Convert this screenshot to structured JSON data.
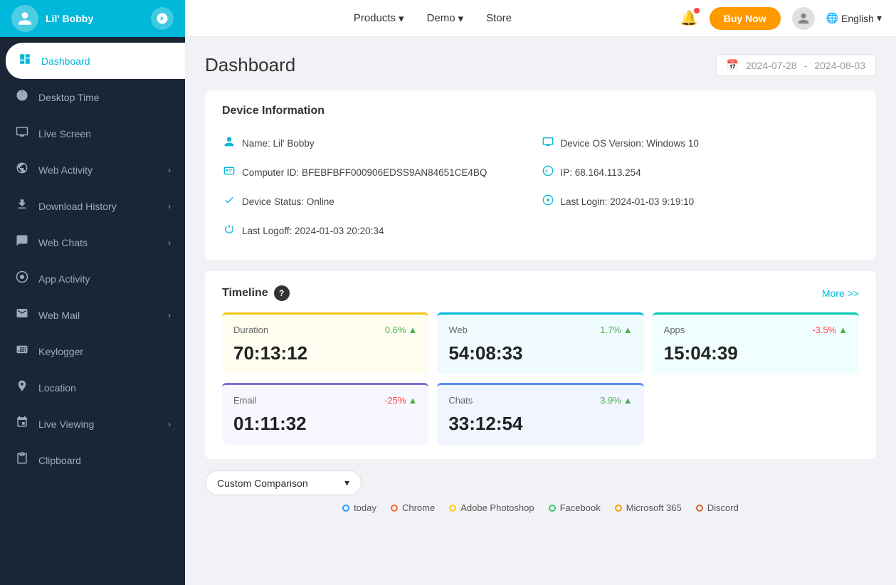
{
  "topNav": {
    "userName": "Lil' Bobby",
    "products": "Products",
    "demo": "Demo",
    "store": "Store",
    "buyNow": "Buy Now",
    "language": "English"
  },
  "sidebar": {
    "items": [
      {
        "id": "dashboard",
        "label": "Dashboard",
        "icon": "⊙",
        "active": true,
        "hasChevron": false
      },
      {
        "id": "desktop-time",
        "label": "Desktop Time",
        "icon": "🕐",
        "active": false,
        "hasChevron": false
      },
      {
        "id": "live-screen",
        "label": "Live Screen",
        "icon": "🖥",
        "active": false,
        "hasChevron": false
      },
      {
        "id": "web-activity",
        "label": "Web Activity",
        "icon": "🌐",
        "active": false,
        "hasChevron": true
      },
      {
        "id": "download-history",
        "label": "Download History",
        "icon": "⬇",
        "active": false,
        "hasChevron": true
      },
      {
        "id": "web-chats",
        "label": "Web Chats",
        "icon": "💬",
        "active": false,
        "hasChevron": true
      },
      {
        "id": "app-activity",
        "label": "App Activity",
        "icon": "⊙",
        "active": false,
        "hasChevron": false
      },
      {
        "id": "web-mail",
        "label": "Web Mail",
        "icon": "✉",
        "active": false,
        "hasChevron": true
      },
      {
        "id": "keylogger",
        "label": "Keylogger",
        "icon": "⌨",
        "active": false,
        "hasChevron": false
      },
      {
        "id": "location",
        "label": "Location",
        "icon": "📍",
        "active": false,
        "hasChevron": false
      },
      {
        "id": "live-viewing",
        "label": "Live Viewing",
        "icon": "📅",
        "active": false,
        "hasChevron": true
      },
      {
        "id": "clipboard",
        "label": "Clipboard",
        "icon": "📋",
        "active": false,
        "hasChevron": false
      }
    ]
  },
  "dashboard": {
    "title": "Dashboard",
    "dateFrom": "2024-07-28",
    "dateTo": "2024-08-03",
    "dateSeparator": "-"
  },
  "deviceInfo": {
    "sectionTitle": "Device Information",
    "name": "Name: Lil' Bobby",
    "deviceOS": "Device OS Version: Windows 10",
    "computerID": "Computer ID: BFEBFBFF000906EDSS9AN84651CE4BQ",
    "ip": "IP: 68.164.113.254",
    "deviceStatus": "Device Status: Online",
    "lastLogin": "Last Login: 2024-01-03 9:19:10",
    "lastLogoff": "Last Logoff: 2024-01-03 20:20:34"
  },
  "timeline": {
    "title": "Timeline",
    "moreLabel": "More >>",
    "stats": [
      {
        "label": "Duration",
        "change": "0.6%",
        "changeDir": "up",
        "value": "70:13:12",
        "borderColor": "yellow",
        "bg": "fffdf0",
        "topColor": "#f5c518"
      },
      {
        "label": "Web",
        "change": "1.7%",
        "changeDir": "up",
        "value": "54:08:33",
        "borderColor": "blue",
        "bg": "f0fbff",
        "topColor": "#00b8d9"
      },
      {
        "label": "Apps",
        "change": "-3.5%",
        "changeDir": "up",
        "value": "15:04:39",
        "borderColor": "teal",
        "bg": "f0fffd",
        "topColor": "#00c9b1"
      }
    ],
    "stats2": [
      {
        "label": "Email",
        "change": "-25%",
        "changeDir": "up",
        "value": "01:11:32",
        "borderColor": "purple",
        "bg": "f8f7ff",
        "topColor": "#7c6fcd"
      },
      {
        "label": "Chats",
        "change": "3.9%",
        "changeDir": "up",
        "value": "33:12:54",
        "borderColor": "indigo",
        "bg": "f0f5ff",
        "topColor": "#5b8af0"
      }
    ]
  },
  "comparison": {
    "dropdownLabel": "Custom Comparison",
    "legend": [
      {
        "label": "today",
        "color": "#3399ff"
      },
      {
        "label": "Chrome",
        "color": "#ff6633"
      },
      {
        "label": "Adobe Photoshop",
        "color": "#ffcc00"
      },
      {
        "label": "Facebook",
        "color": "#33cc66"
      },
      {
        "label": "Microsoft 365",
        "color": "#ff9900"
      },
      {
        "label": "Discord",
        "color": "#cc6633"
      }
    ]
  }
}
